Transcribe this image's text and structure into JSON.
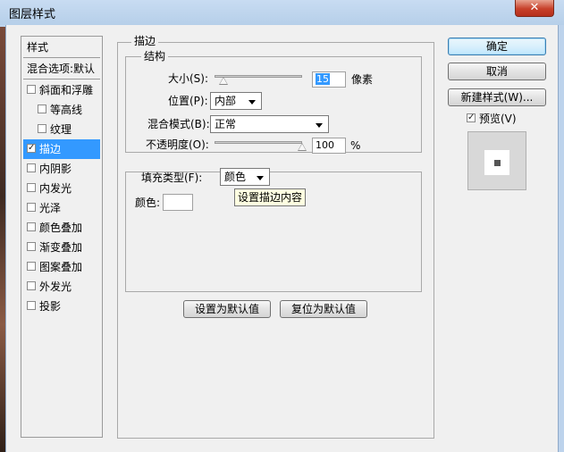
{
  "window": {
    "title": "图层样式",
    "close_glyph": "✕"
  },
  "styles_list": {
    "header": "样式",
    "blend_options": "混合选项:默认",
    "items": [
      {
        "label": "斜面和浮雕",
        "checked": false
      },
      {
        "label": "等高线",
        "checked": false
      },
      {
        "label": "纹理",
        "checked": false
      },
      {
        "label": "描边",
        "checked": true,
        "selected": true
      },
      {
        "label": "内阴影",
        "checked": false
      },
      {
        "label": "内发光",
        "checked": false
      },
      {
        "label": "光泽",
        "checked": false
      },
      {
        "label": "颜色叠加",
        "checked": false
      },
      {
        "label": "渐变叠加",
        "checked": false
      },
      {
        "label": "图案叠加",
        "checked": false
      },
      {
        "label": "外发光",
        "checked": false
      },
      {
        "label": "投影",
        "checked": false
      }
    ],
    "check_glyph": "✓"
  },
  "stroke": {
    "group_title": "描边",
    "structure_title": "结构",
    "size_label": "大小(S):",
    "size_value": "15",
    "size_unit": "像素",
    "size_slider_fraction": 0.1,
    "position_label": "位置(P):",
    "position_value": "内部",
    "blend_mode_label": "混合模式(B):",
    "blend_mode_value": "正常",
    "opacity_label": "不透明度(O):",
    "opacity_value": "100",
    "opacity_unit": "%",
    "opacity_fraction": 1.0,
    "fill_type_label": "填充类型(F):",
    "fill_type_value": "颜色",
    "color_label": "颜色:",
    "color_value": "#ffffff",
    "tooltip": "设置描边内容"
  },
  "defaults": {
    "make_default": "设置为默认值",
    "reset_default": "复位为默认值"
  },
  "buttons": {
    "ok": "确定",
    "cancel": "取消",
    "new_style": "新建样式(W)...",
    "preview_label": "预览(V)",
    "preview_checked": true
  }
}
